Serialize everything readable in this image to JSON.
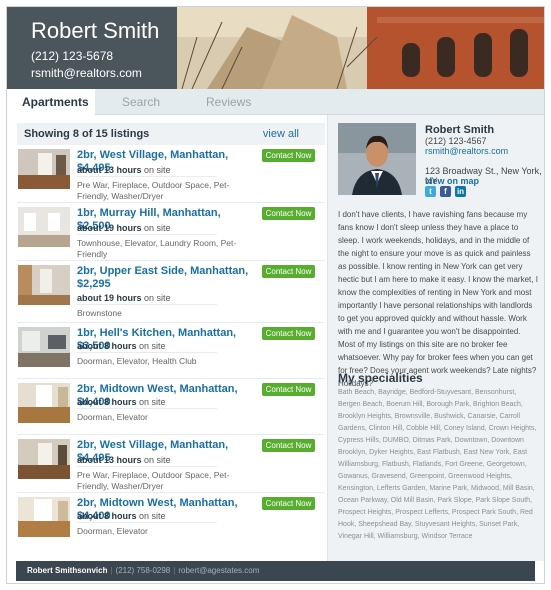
{
  "agent": {
    "name": "Robert Smith",
    "phone": "(212) 123-5678",
    "email": "rsmith@realtors.com"
  },
  "tabs": [
    {
      "label": "Apartments",
      "active": true
    },
    {
      "label": "Search",
      "active": false
    },
    {
      "label": "Reviews",
      "active": false
    }
  ],
  "listings_header": {
    "count": "Showing 8 of 15 listings",
    "view_all": "view all"
  },
  "contact_label": "Contact Now",
  "listings": [
    {
      "title": "2br, West Village, Manhattan, $4,495",
      "hours": "about 13 hours",
      "site": "on site",
      "features": "Pre War, Fireplace, Outdoor Space, Pet-Friendly, Washer/Dryer"
    },
    {
      "title": "1br, Murray Hill, Manhattan, $2,500",
      "hours": "about 19 hours",
      "site": "on site",
      "features": "Townhouse, Elevator, Laundry Room, Pet-Friendly"
    },
    {
      "title": "2br, Upper East Side, Manhattan, $2,295",
      "hours": "about 19 hours",
      "site": "on site",
      "features": "Brownstone"
    },
    {
      "title": "1br, Hell's Kitchen, Manhattan, $3,500",
      "hours": "about 8 hours",
      "site": "on site",
      "features": "Doorman, Elevator, Health Club"
    },
    {
      "title": "2br, Midtown West, Manhattan, $4,400",
      "hours": "about 8 hours",
      "site": "on site",
      "features": "Doorman, Elevator"
    },
    {
      "title": "2br, West Village, Manhattan, $4,495",
      "hours": "about 13 hours",
      "site": "on site",
      "features": "Pre War, Fireplace, Outdoor Space, Pet-Friendly, Washer/Dryer"
    },
    {
      "title": "2br, Midtown West, Manhattan, $4,400",
      "hours": "about 8 hours",
      "site": "on site",
      "features": "Doorman, Elevator"
    }
  ],
  "sidebar": {
    "name": "Robert Smith",
    "phone": "(212) 123-4567",
    "email": "rsmith@realtors.com",
    "address": "123 Broadway St., New York, NY",
    "map_link": "view on map",
    "social": [
      "twitter-icon",
      "facebook-icon",
      "linkedin-icon"
    ],
    "bio": "I don't have clients, I have ravishing fans because my fans know I don't sleep unless they have a place to sleep. I work weekends, holidays, and in the middle of the night to ensure your move is as quick and painless as possible. I know renting in New York can get very hectic but I am here to make it easy. I know the market, I know the complexities of renting in New York and most importantly I have personal relationships with landlords to get you approved quickly and without hassle. Work with me and I guarantee you won't be disappointed. Most of my listings on this site are no broker fee whatsoever. Why pay for broker fees when you can get for free? Does your agent work weekends? Late nights? Holidays?",
    "specialities_title": "My specialities",
    "specialities": "Bath Beach, Bayridge, Bedford-Stuyvesant, Bensonhurst, Bergen Beach, Boerum Hill, Borough Park, Brighton Beach, Brooklyn Heights, Brownsville, Bushwick, Canarsie, Carroll Gardens, Clinton Hill, Cobble Hill, Coney Island, Crown Heights, Cypress Hills, DUMBO, Ditmas Park, Downtown, Downtown Brooklyn, Dyker Heights, East Flatbush, East New York, East Williamsburg, Flatbush, Flatlands, Fort Greene, Georgetown, Gowanus, Gravesend, Greenpoint, Greenwood Heights, Kensington, Lefferts Garden, Marine Park, Midwood, Mill Basin, Ocean Parkway, Old Mill Basin, Park Slope, Park Slope South, Prospect Heights, Prospect Lefferts, Prospect Park South, Red Hook, Sheepshead Bay, Stuyvesant Heights, Sunset Park, Vinegar Hill, Williamsburg, Windsor Terrace"
  },
  "footer": {
    "name": "Robert Smithsonvich",
    "phone": "(212) 758-0298",
    "email": "robert@agestates.com"
  }
}
